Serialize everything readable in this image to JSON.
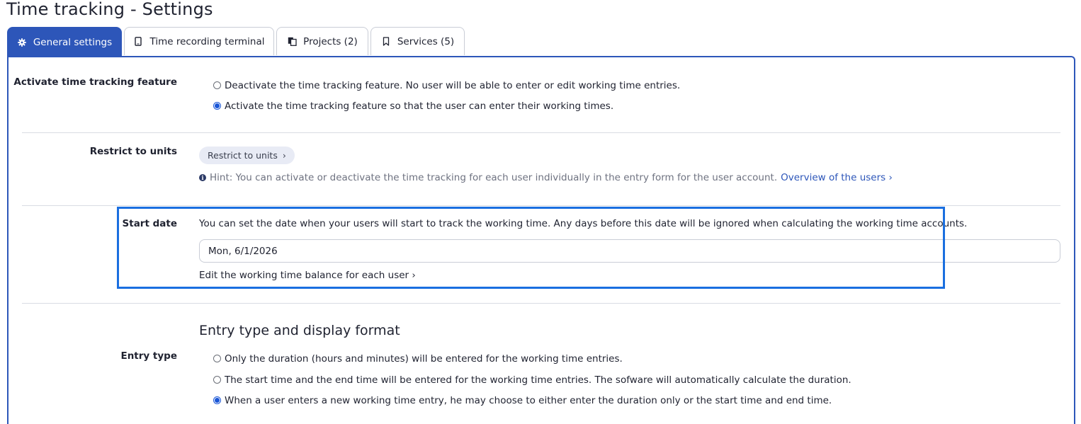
{
  "page": {
    "title": "Time tracking - Settings"
  },
  "tabs": [
    {
      "label": "General settings",
      "icon": "gear-icon"
    },
    {
      "label": "Time recording terminal",
      "icon": "tablet-icon"
    },
    {
      "label": "Projects (2)",
      "icon": "folders-icon"
    },
    {
      "label": "Services (5)",
      "icon": "bookmark-icon"
    }
  ],
  "activation": {
    "label": "Activate time tracking feature",
    "options": [
      {
        "text": "Deactivate the time tracking feature. No user will be able to enter or edit working time entries.",
        "checked": false
      },
      {
        "text": "Activate the time tracking feature so that the user can enter their working times.",
        "checked": true
      }
    ]
  },
  "restrict": {
    "label": "Restrict to units",
    "button": "Restrict to units",
    "button_chevron": "›",
    "hint": "Hint: You can activate or deactivate the time tracking for each user individually in the entry form for the user account.",
    "link": "Overview of the users ›"
  },
  "start_date": {
    "label": "Start date",
    "description": "You can set the date when your users will start to track the working time. Any days before this date will be ignored when calculating the working time accounts.",
    "value": "Mon, 6/1/2026",
    "link": "Edit the working time balance for each user ›"
  },
  "entry_type": {
    "heading": "Entry type and display format",
    "label": "Entry type",
    "options": [
      {
        "text": "Only the duration (hours and minutes) will be entered for the working time entries.",
        "checked": false
      },
      {
        "text": "The start time and the end time will be entered for the working time entries. The sofware will automatically calculate the duration.",
        "checked": false
      },
      {
        "text": "When a user enters a new working time entry, he may choose to either enter the duration only or the start time and end time.",
        "checked": true
      }
    ]
  }
}
